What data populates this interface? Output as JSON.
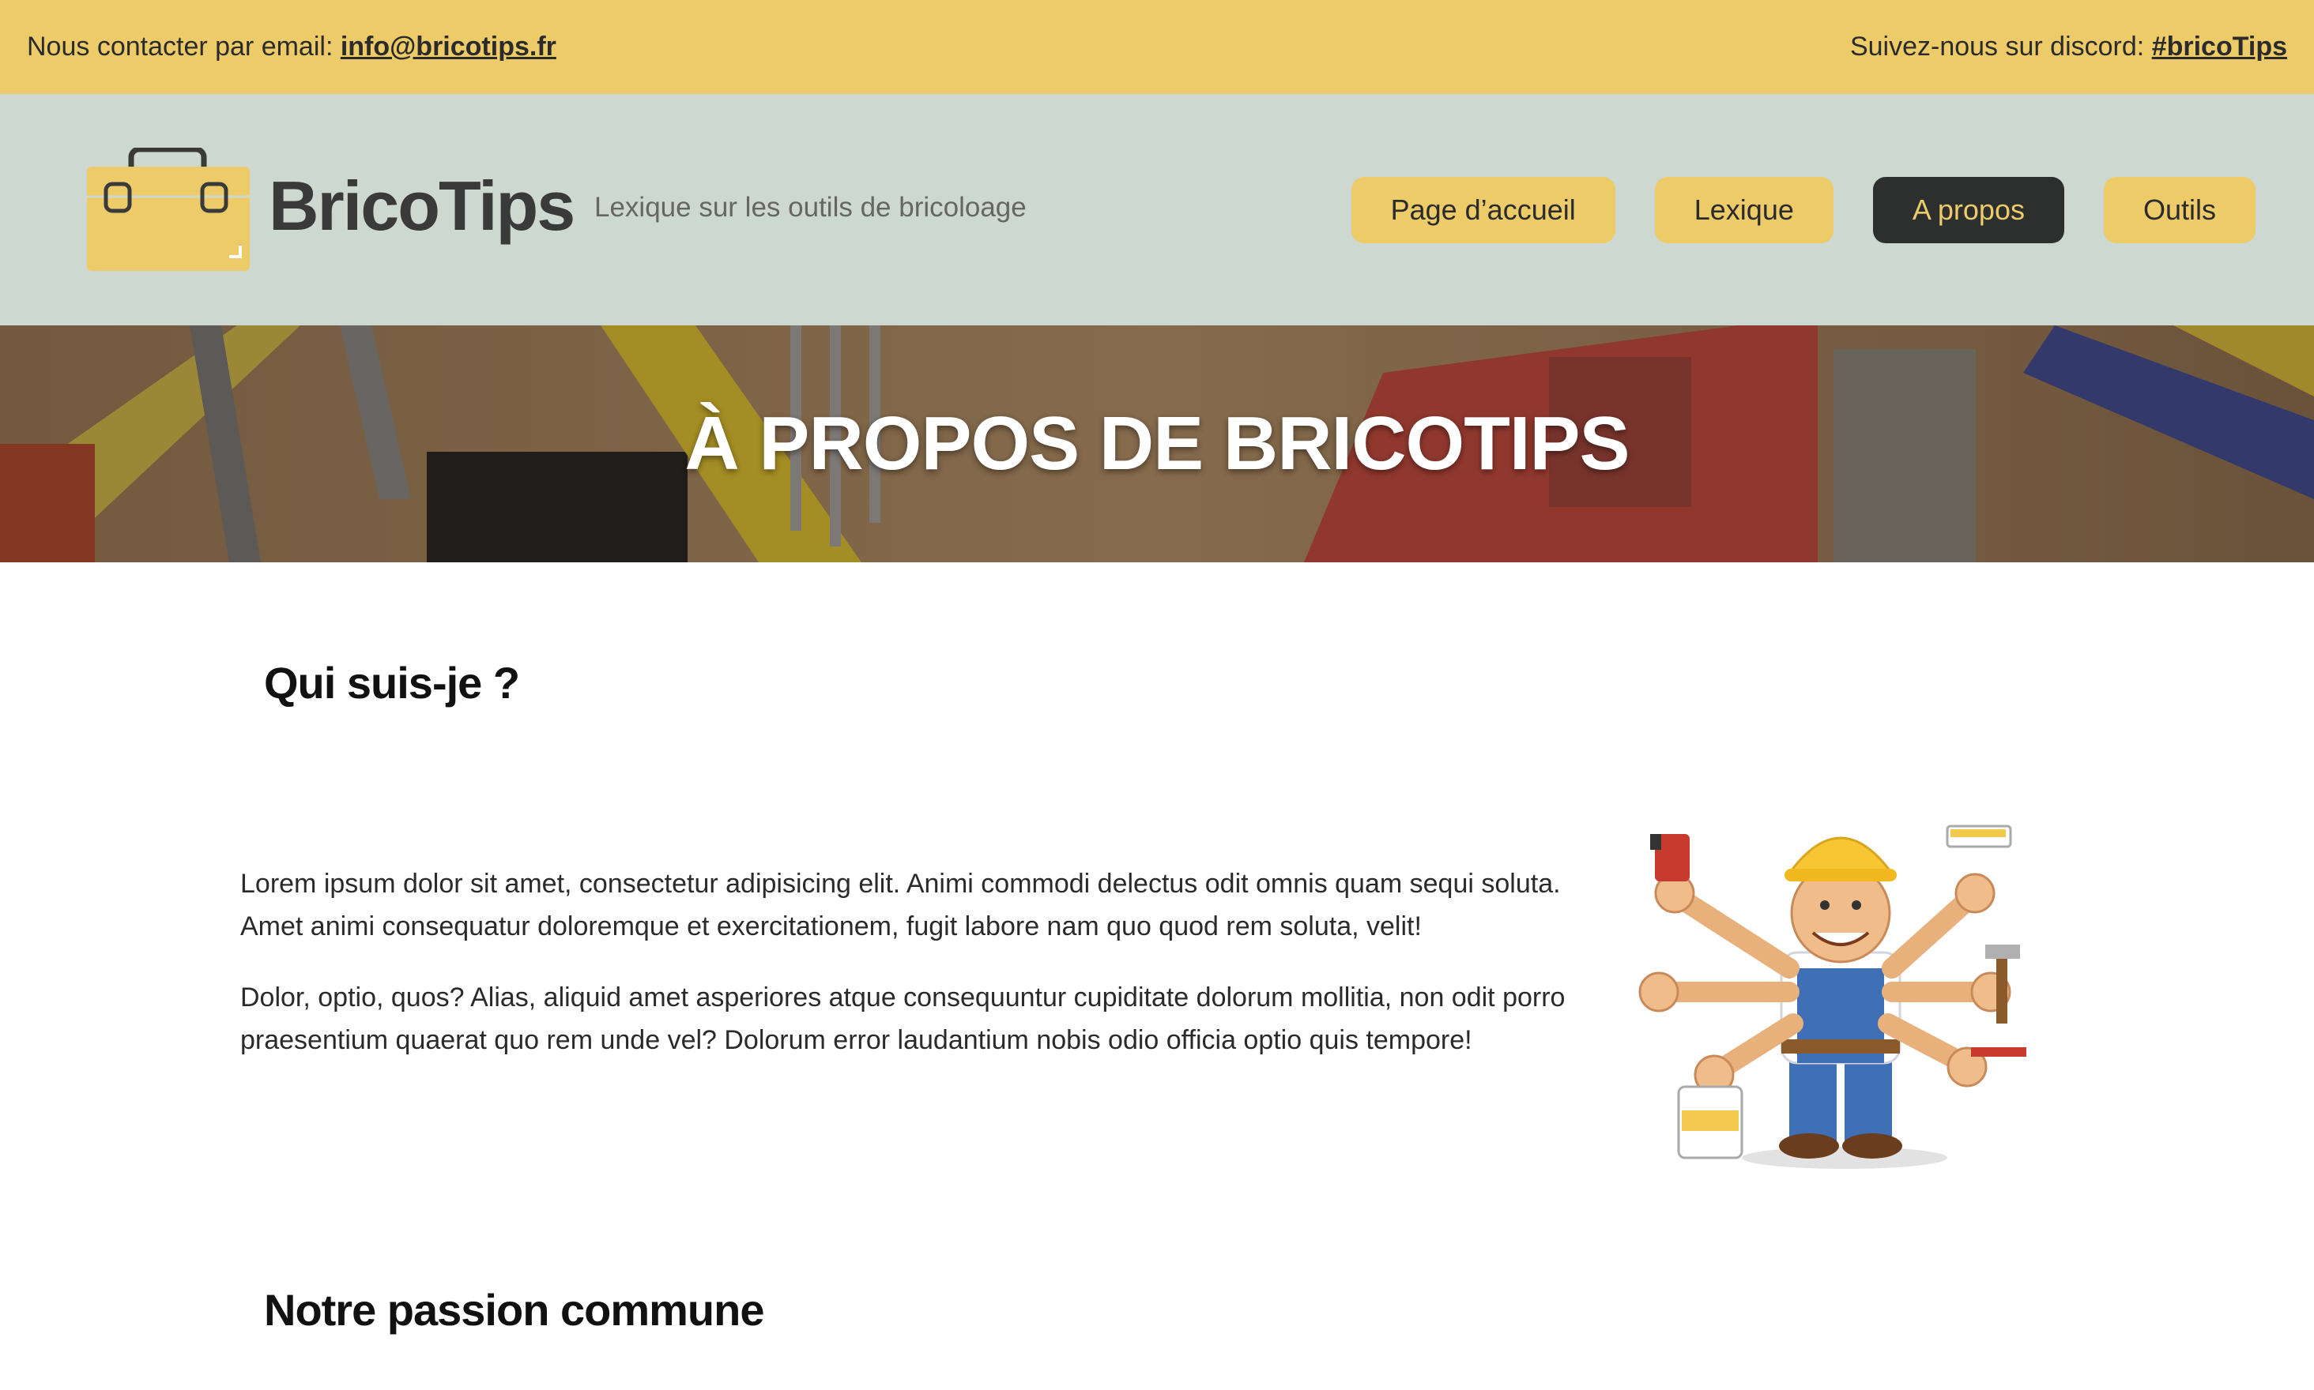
{
  "topbar": {
    "contact_prefix": "Nous contacter par email: ",
    "contact_email": "info@bricotips.fr",
    "discord_prefix": "Suivez-nous sur discord: ",
    "discord_handle": "#bricoTips"
  },
  "header": {
    "logo_text": "BricoTips",
    "tagline": "Lexique sur les outils de bricoloage",
    "nav": [
      {
        "label": "Page d’accueil",
        "active": false
      },
      {
        "label": "Lexique",
        "active": false
      },
      {
        "label": "A propos",
        "active": true
      },
      {
        "label": "Outils",
        "active": false
      }
    ]
  },
  "hero": {
    "title": "À PROPOS DE BRICOTIPS"
  },
  "main": {
    "section1_title": "Qui suis-je ?",
    "paragraph1": "Lorem ipsum dolor sit amet, consectetur adipisicing elit. Animi commodi delectus odit omnis quam sequi soluta. Amet animi consequatur doloremque et exercitationem, fugit labore nam quo quod rem soluta, velit!",
    "paragraph2": "Dolor, optio, quos? Alias, aliquid amet asperiores atque consequuntur cupiditate dolorum mollitia, non odit porro praesentium quaerat quo rem unde vel? Dolorum error laudantium nobis odio officia optio quis tempore!",
    "section2_title": "Notre passion commune"
  },
  "colors": {
    "accent": "#edcb69",
    "header_bg": "#ccd8d0",
    "active_nav_bg": "#2c2f2e"
  },
  "icons": [
    "toolbox-logo-icon",
    "handyman-illustration"
  ]
}
